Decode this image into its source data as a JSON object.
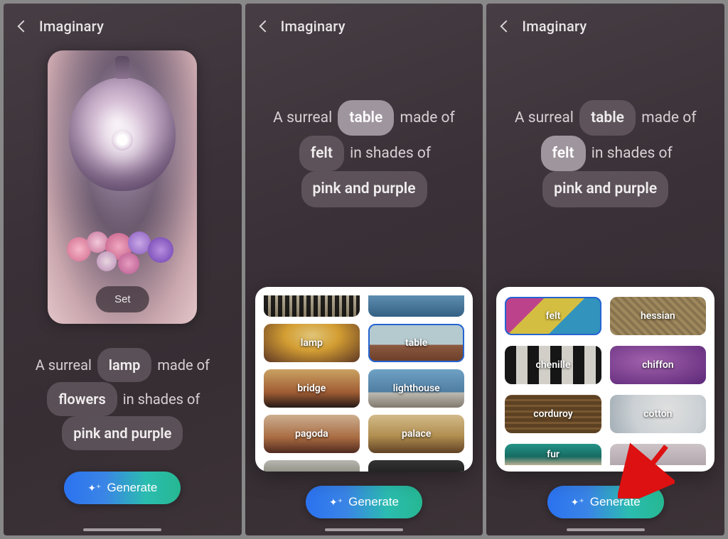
{
  "app_title": "Imaginary",
  "set_label": "Set",
  "generate_label": "Generate",
  "pane1_prompt": {
    "pre1": "A surreal ",
    "chip1": "lamp",
    "post1": " made of",
    "chip2": "flowers",
    "mid2": " in shades of",
    "chip3": "pink and purple"
  },
  "pane2_prompt": {
    "pre1": "A surreal ",
    "chip1": "table",
    "post1": " made of",
    "chip2": "felt",
    "mid2": " in shades of",
    "chip3": "pink and purple"
  },
  "pane3_prompt": {
    "pre1": "A surreal ",
    "chip1": "table",
    "post1": " made of",
    "chip2": "felt",
    "mid2": " in shades of",
    "chip3": "pink and purple"
  },
  "tray_objects": {
    "row0": [
      "",
      ""
    ],
    "row1": [
      "lamp",
      "table"
    ],
    "row2": [
      "bridge",
      "lighthouse"
    ],
    "row3": [
      "pagoda",
      "palace"
    ],
    "row4": [
      "",
      ""
    ]
  },
  "tray_materials": {
    "row1": [
      "felt",
      "hessian"
    ],
    "row2": [
      "chenille",
      "chiffon"
    ],
    "row3": [
      "corduroy",
      "cotton"
    ],
    "row4": [
      "fur",
      ""
    ]
  }
}
